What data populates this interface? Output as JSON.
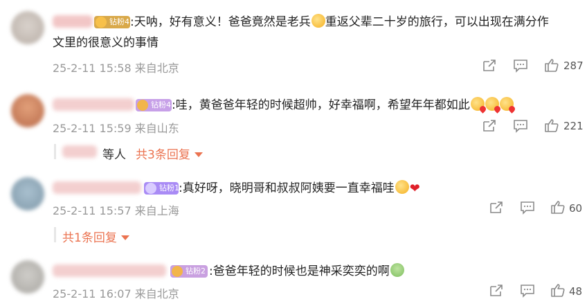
{
  "comments": [
    {
      "badge": "钻粉4",
      "text_line1": ":天呐，好有意义！爸爸竟然是老兵",
      "text_line1b": "重返父辈二十岁的旅行，可以出现在满分作",
      "text_line2": "文里的很意义的事情",
      "time": "25-2-11 15:58",
      "location": "来自北京",
      "likes": "287"
    },
    {
      "badge": "钻粉4",
      "text": ":哇，黄爸爸年轻的时候超帅，好幸福啊，希望年年都如此",
      "time": "25-2-11 15:59",
      "location": "来自山东",
      "likes": "221",
      "replies_by": "等人",
      "replies_link": "共3条回复"
    },
    {
      "badge": "钻粉1",
      "text": ":真好呀，晓明哥和叔叔阿姨要一直幸福哇",
      "time": "25-2-11 15:57",
      "location": "来自上海",
      "likes": "60",
      "replies_link": "共1条回复"
    },
    {
      "badge": "钻粉2",
      "text": ":爸爸年轻的时候也是神采奕奕的啊",
      "time": "25-2-11 16:07",
      "location": "来自北京",
      "likes": "48"
    }
  ],
  "colors": {
    "badge_gold": "#f5a623",
    "badge_purple": "#a98bf5",
    "link_orange": "#eb7350",
    "meta_gray": "#999999"
  },
  "icons": [
    "share-icon",
    "comment-icon",
    "like-icon",
    "emoji-face",
    "emoji-kiss",
    "emoji-heart",
    "emoji-frog"
  ]
}
